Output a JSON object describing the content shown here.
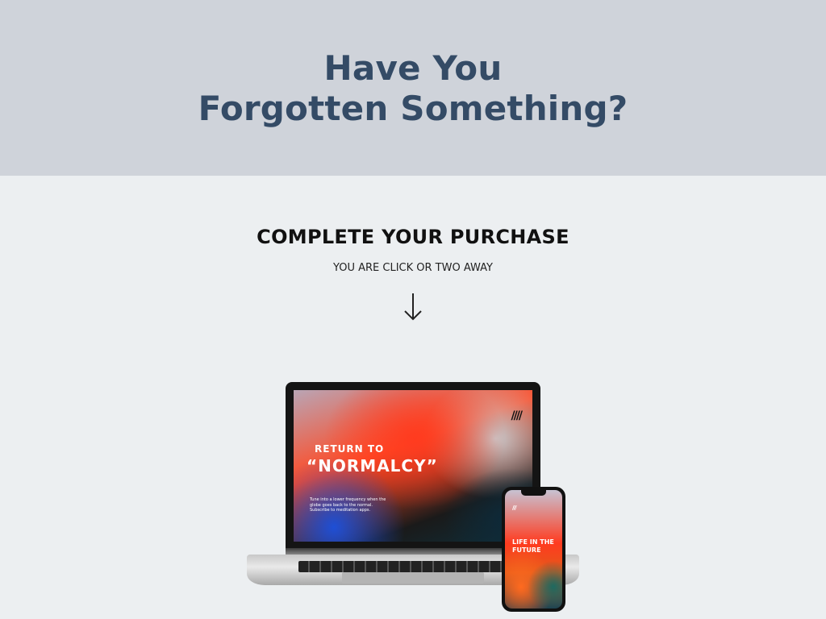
{
  "hero": {
    "title_line1": "Have You",
    "title_line2": "Forgotten Something?"
  },
  "cta": {
    "heading": "COMPLETE YOUR PURCHASE",
    "subheading": "YOU ARE CLICK OR TWO AWAY",
    "arrow_icon": "arrow-down-icon"
  },
  "product_image": {
    "laptop_screen": {
      "line1": "RETURN TO",
      "line2": "“NORMALCY”",
      "body": "Tune into a lower frequency when the globe goes back to the normal. Subscribe to meditation apps."
    },
    "phone_screen": {
      "title": "LIFE IN THE FUTURE"
    },
    "logo_icon": "brand-slashes-icon"
  },
  "colors": {
    "hero_bg": "#cfd3da",
    "hero_text": "#344b66",
    "content_bg": "#eceff1"
  }
}
